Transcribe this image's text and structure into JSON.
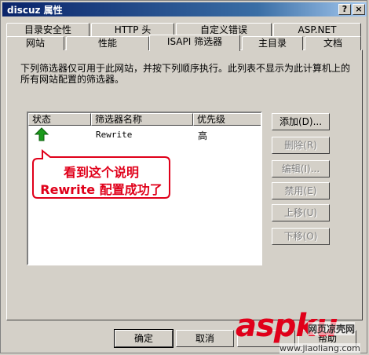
{
  "window": {
    "title": "discuz 属性",
    "help_label": "?",
    "close_label": "×"
  },
  "tabs_back": [
    "目录安全性",
    "HTTP 头",
    "自定义错误",
    "ASP.NET"
  ],
  "tabs_front": [
    "网站",
    "性能",
    "ISAPI 筛选器",
    "主目录",
    "文档"
  ],
  "selected_tab": "ISAPI 筛选器",
  "description": "下列筛选器仅可用于此网站，并按下列顺序执行。此列表不显示为此计算机上的所有网站配置的筛选器。",
  "list": {
    "columns": [
      "状态",
      "筛选器名称",
      "优先级"
    ],
    "rows": [
      {
        "status_icon": "green-up-arrow-icon",
        "name": "Rewrite",
        "priority": "高"
      }
    ]
  },
  "buttons": {
    "add": "添加(D)...",
    "remove": "删除(R)",
    "edit": "编辑(I)...",
    "disable": "禁用(E)",
    "move_up": "上移(U)",
    "move_down": "下移(O)"
  },
  "callout": {
    "line1": "看到这个说明",
    "line2": "Rewrite 配置成功了"
  },
  "footer": {
    "ok": "确定",
    "cancel": "取消",
    "help": "帮助"
  },
  "watermark": {
    "logo": "aspku",
    "site": "网页凉壳网",
    "url": "www.jiaoliang.com"
  },
  "colors": {
    "title_start": "#0a246a",
    "callout_red": "#e0001a",
    "arrow_green": "#1a9a1a"
  }
}
